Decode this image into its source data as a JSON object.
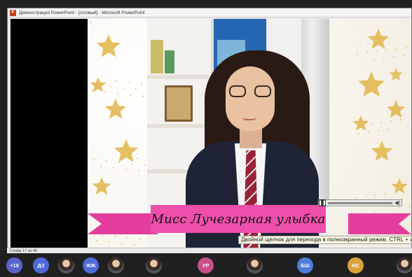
{
  "window": {
    "title": "Демонстрация PowerPoint - [готовый] - Microsoft PowerPoint",
    "app_icon": "P"
  },
  "slide": {
    "banner_text": "Мисс Лучезарная улыбка",
    "accent_colors": {
      "banner": "#ee4fab",
      "banner_tail": "#e43e9c",
      "stars": "#e0b548"
    }
  },
  "media_player": {
    "play_icon": "pause-icon",
    "progress": 0.0
  },
  "tooltip": "Двойной щелчок для перехода в полноэкранный режим, CTRL + щелчок — для настройки",
  "status_bar": {
    "slide_counter": "Слайд 17 из 40"
  },
  "participants": [
    {
      "initials": "+19",
      "color": "#5a63c9"
    },
    {
      "initials": "ДЗ",
      "color": "#4e6ad8"
    },
    {
      "initials": "",
      "color": "#3a2b26",
      "photo": true
    },
    {
      "initials": "ЖЖ",
      "color": "#4e6ad8"
    },
    {
      "initials": "",
      "color": "#3a2b26",
      "photo": true
    },
    {
      "initials": "",
      "color": "#3a2b26",
      "photo": true
    },
    {
      "initials": "УР",
      "color": "#c94e8a"
    },
    {
      "initials": "",
      "color": "#3a2b26",
      "photo": true
    },
    {
      "initials": "БШ",
      "color": "#4b7dd9"
    },
    {
      "initials": "НС",
      "color": "#d9a23a"
    },
    {
      "initials": "",
      "color": "#3a2b26",
      "photo": true
    }
  ]
}
